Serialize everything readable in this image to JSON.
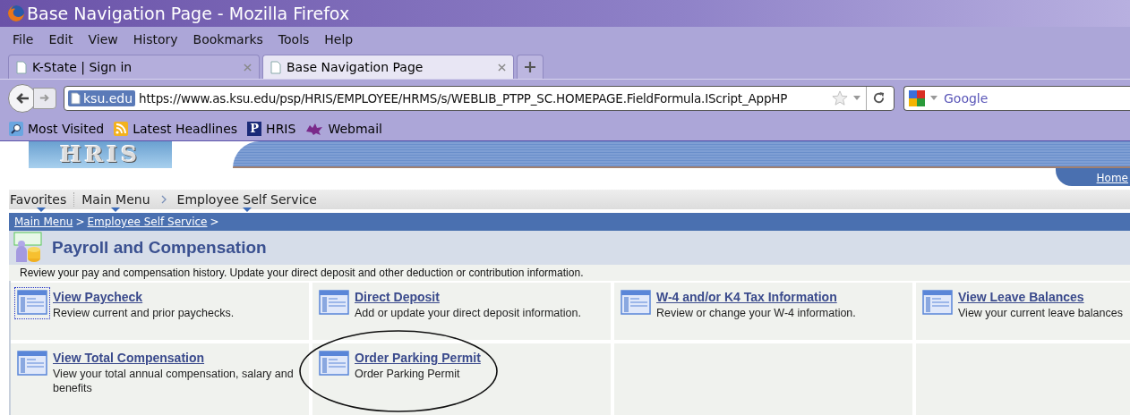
{
  "window": {
    "title": "Base Navigation Page - Mozilla Firefox"
  },
  "menu": [
    "File",
    "Edit",
    "View",
    "History",
    "Bookmarks",
    "Tools",
    "Help"
  ],
  "tabs": [
    {
      "label": "K-State | Sign in",
      "selected": false
    },
    {
      "label": "Base Navigation Page",
      "selected": true
    }
  ],
  "address_bar": {
    "site_badge": "ksu.edu",
    "value": "https://www.as.ksu.edu/psp/HRIS/EMPLOYEE/HRMS/s/WEBLIB_PTPP_SC.HOMEPAGE.FieldFormula.IScript_AppHP"
  },
  "search": {
    "placeholder": "Google"
  },
  "bookmarks": [
    {
      "label": "Most Visited",
      "kind": "search"
    },
    {
      "label": "Latest Headlines",
      "kind": "feed"
    },
    {
      "label": "HRIS",
      "kind": "letter",
      "letter": "P"
    },
    {
      "label": "Webmail",
      "kind": "cat"
    }
  ],
  "page": {
    "logo": "HRIS",
    "home_link": "Home",
    "nav": [
      {
        "label": "Favorites"
      },
      {
        "label": "Main Menu"
      },
      {
        "label": "Employee Self Service"
      }
    ],
    "breadcrumb": [
      {
        "label": "Main Menu",
        "separator": ">"
      },
      {
        "label": "Employee Self Service",
        "separator": ">"
      }
    ],
    "title": "Payroll and Compensation",
    "description": "Review your pay and compensation history. Update your direct deposit and other deduction or contribution information.",
    "tiles": [
      {
        "title": "View Paycheck",
        "text": "Review current and prior paychecks.",
        "focused": true,
        "circled": false
      },
      {
        "title": "Direct Deposit",
        "text": "Add or update your direct deposit information.",
        "focused": false,
        "circled": false
      },
      {
        "title": "W-4 and/or K4 Tax Information",
        "text": "Review or change your W-4 information.",
        "focused": false,
        "circled": false
      },
      {
        "title": "View Leave Balances",
        "text": "View your current leave balances",
        "focused": false,
        "circled": false
      },
      {
        "title": "View Total Compensation",
        "text": "View your total annual compensation, salary and benefits",
        "focused": false,
        "circled": false
      },
      {
        "title": "Order Parking Permit",
        "text": "Order Parking Permit",
        "focused": false,
        "circled": true
      }
    ]
  }
}
